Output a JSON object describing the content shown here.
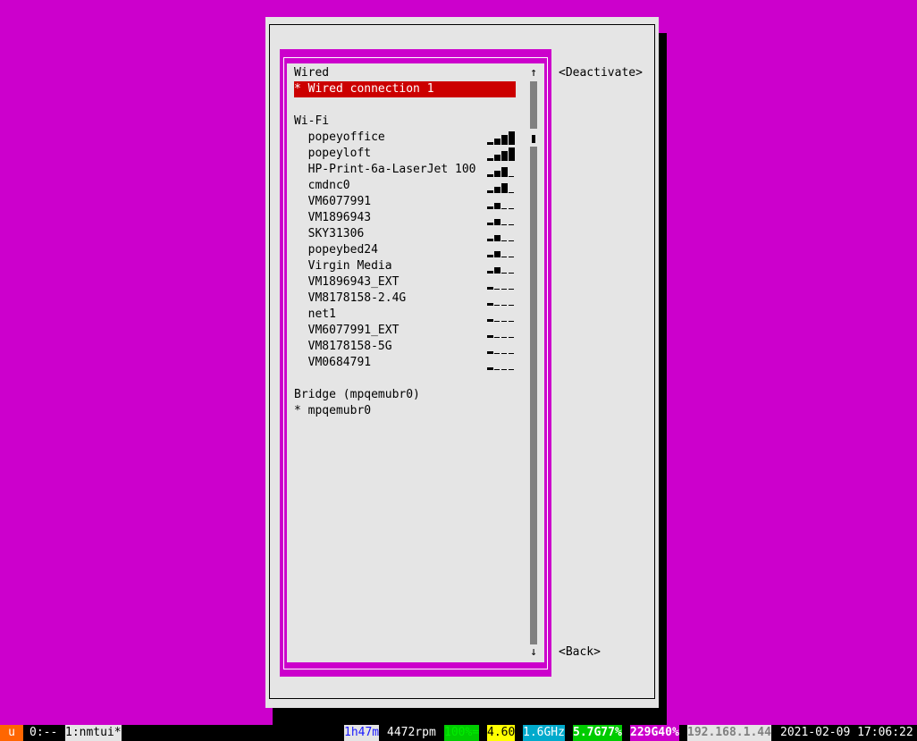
{
  "dialog": {
    "deactivate_label": "<Deactivate>",
    "back_label": "<Back>",
    "scroll_up": "↑",
    "scroll_down": "↓"
  },
  "groups": {
    "wired": {
      "header": "Wired",
      "items": [
        {
          "label": "* Wired connection 1",
          "selected": true
        }
      ]
    },
    "wifi": {
      "header": "Wi-Fi",
      "items": [
        {
          "label": "  popeyoffice",
          "signal": 4
        },
        {
          "label": "  popeyloft",
          "signal": 4
        },
        {
          "label": "  HP-Print-6a-LaserJet 100",
          "signal": 3
        },
        {
          "label": "  cmdnc0",
          "signal": 3
        },
        {
          "label": "  VM6077991",
          "signal": 2
        },
        {
          "label": "  VM1896943",
          "signal": 2
        },
        {
          "label": "  SKY31306",
          "signal": 2
        },
        {
          "label": "  popeybed24",
          "signal": 2
        },
        {
          "label": "  Virgin Media",
          "signal": 2
        },
        {
          "label": "  VM1896943_EXT",
          "signal": 1
        },
        {
          "label": "  VM8178158-2.4G",
          "signal": 1
        },
        {
          "label": "  net1",
          "signal": 1
        },
        {
          "label": "  VM6077991_EXT",
          "signal": 1
        },
        {
          "label": "  VM8178158-5G",
          "signal": 1
        },
        {
          "label": "  VM0684791",
          "signal": 1
        }
      ]
    },
    "bridge": {
      "header": "Bridge (mpqemubr0)",
      "items": [
        {
          "label": "* mpqemubr0"
        }
      ]
    }
  },
  "statusbar": {
    "session": "u",
    "win0": "0:--",
    "win1": "1:nmtui*",
    "uptime": "1h47m",
    "fan": "4472rpm",
    "battery": "100%=",
    "load": "4.60",
    "cpu_freq": "1.6GHz",
    "mem": "5.7G77%",
    "disk": "229G40%",
    "ip": "192.168.1.44",
    "datetime": "2021-02-09 17:06:22"
  },
  "colors": {
    "background": "#cc00cc",
    "dialog": "#e5e5e5",
    "selection": "#cc0000"
  }
}
